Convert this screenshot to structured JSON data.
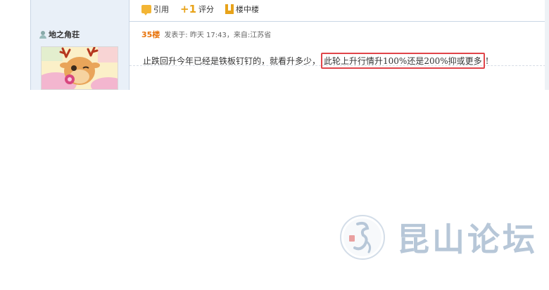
{
  "prev_post": {
    "actions": [
      {
        "label": "引用",
        "icon": "quote-icon"
      },
      {
        "label": "评分",
        "icon": "rate-plus-one-icon"
      },
      {
        "label": "楼中楼",
        "icon": "floor-in-floor-icon"
      }
    ]
  },
  "post": {
    "author": {
      "username": "地之角荘",
      "icon": "user-icon",
      "avatar": "reindeer-cartoon-avatar"
    },
    "floor": "35楼",
    "meta": "发表于: 昨天 17:43，来自:江苏省",
    "content_plain": "止跌回升今年已经是铁板钉钉的，就看升多少，",
    "content_highlight": "此轮上升行情升100%还是200%抑或更多",
    "content_tail": "!",
    "highlight_color": "#e0454a"
  },
  "watermark": {
    "logo": "kunshan-forum-logo",
    "text": "昆山论坛",
    "color": "#b7c7d8"
  }
}
